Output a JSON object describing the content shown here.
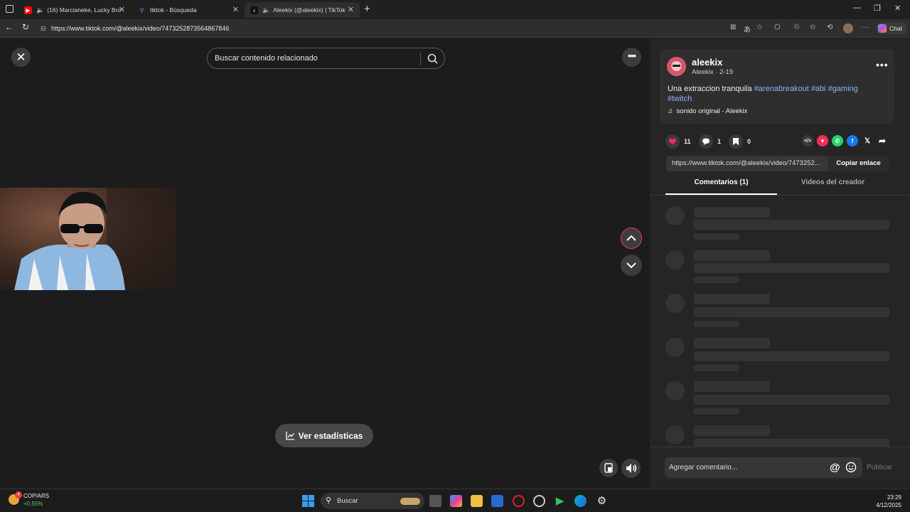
{
  "browser": {
    "tabs": [
      {
        "label": "(16) Marcianeke, Lucky Brown",
        "icon": "youtube-icon",
        "color": "#ff0000"
      },
      {
        "label": "tiktok - Búsqueda",
        "icon": "bing-search-icon",
        "color": "#2b7cd3"
      },
      {
        "label": "Aleekix (@aleekix) | TikTok",
        "icon": "tiktok-icon",
        "color": "#000000"
      }
    ],
    "url": "https://www.tiktok.com/@aleekix/video/7473252873564867846",
    "copilot_label": "Chat"
  },
  "video": {
    "search_placeholder": "Buscar contenido relacionado",
    "stats_label": "Ver estadísticas"
  },
  "post": {
    "username": "aleekix",
    "display_name_date": "Aleekix · 2-19",
    "caption_text": "Una extraccion tranquila",
    "hashtags": [
      "#arenabreakout",
      "#abi",
      "#gaming",
      "#twitch"
    ],
    "music": "sonido original - Aleekix",
    "likes": "11",
    "comments": "1",
    "saves": "0",
    "link": "https://www.tiktok.com/@aleekix/video/7473252...",
    "copy_label": "Copiar enlace",
    "accent_color": "#fe2c55"
  },
  "tabs": {
    "comments": "Comentarios (1)",
    "creator_videos": "Videos del creador"
  },
  "comment_box": {
    "placeholder": "Agregar comentario...",
    "at": "@",
    "publish": "Publicar"
  },
  "taskbar": {
    "ticker_pair": "COP/ARS",
    "ticker_change": "+0.55%",
    "ticker_badge": "4",
    "search_label": "Buscar",
    "time": "23:29",
    "date": "4/12/2025"
  }
}
